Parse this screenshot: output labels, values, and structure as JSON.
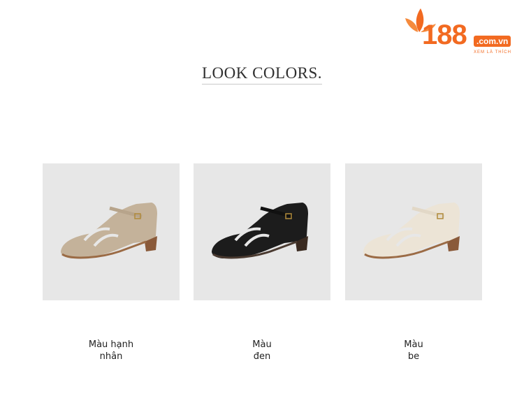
{
  "logo": {
    "number": "188",
    "domain": ".com.vn",
    "tagline": "XEM LÀ THÍCH"
  },
  "heading": "LOOK COLORS.",
  "products": [
    {
      "line1": "Màu hạnh",
      "line2": "nhân",
      "color": "#c4b29a",
      "strap": "#b7a48b"
    },
    {
      "line1": "Màu",
      "line2": "đen",
      "color": "#1c1c1c",
      "strap": "#111111"
    },
    {
      "line1": "Màu",
      "line2": "be",
      "color": "#ece4d6",
      "strap": "#e2d8c7"
    }
  ]
}
